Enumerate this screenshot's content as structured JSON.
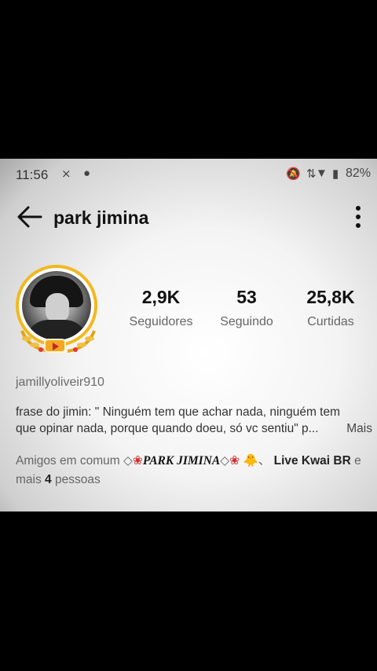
{
  "status_bar": {
    "time": "11:56",
    "battery": "82%"
  },
  "header": {
    "title": "park jimina"
  },
  "stats": [
    {
      "value": "2,9K",
      "label": "Seguidores"
    },
    {
      "value": "53",
      "label": "Seguindo"
    },
    {
      "value": "25,8K",
      "label": "Curtidas"
    }
  ],
  "profile": {
    "username": "jamillyoliveir910",
    "bio_line1": "frase do jimin: \" Ninguém tem que achar nada, ninguém tem",
    "bio_line2": "que opinar nada, porque quando doeu, só vc sentiu\" p...",
    "bio_more": "Mais"
  },
  "friends": {
    "prefix": "Amigos em comum",
    "friend1": "PARK JIMINA",
    "emoji": "🐥",
    "sep": "、",
    "friend2": "Live Kwai BR",
    "and": "e",
    "mais": "mais",
    "count": "4",
    "suffix": "pessoas"
  },
  "colors": {
    "ring": "#f2b81f",
    "accent_badge": "#f5a623"
  }
}
